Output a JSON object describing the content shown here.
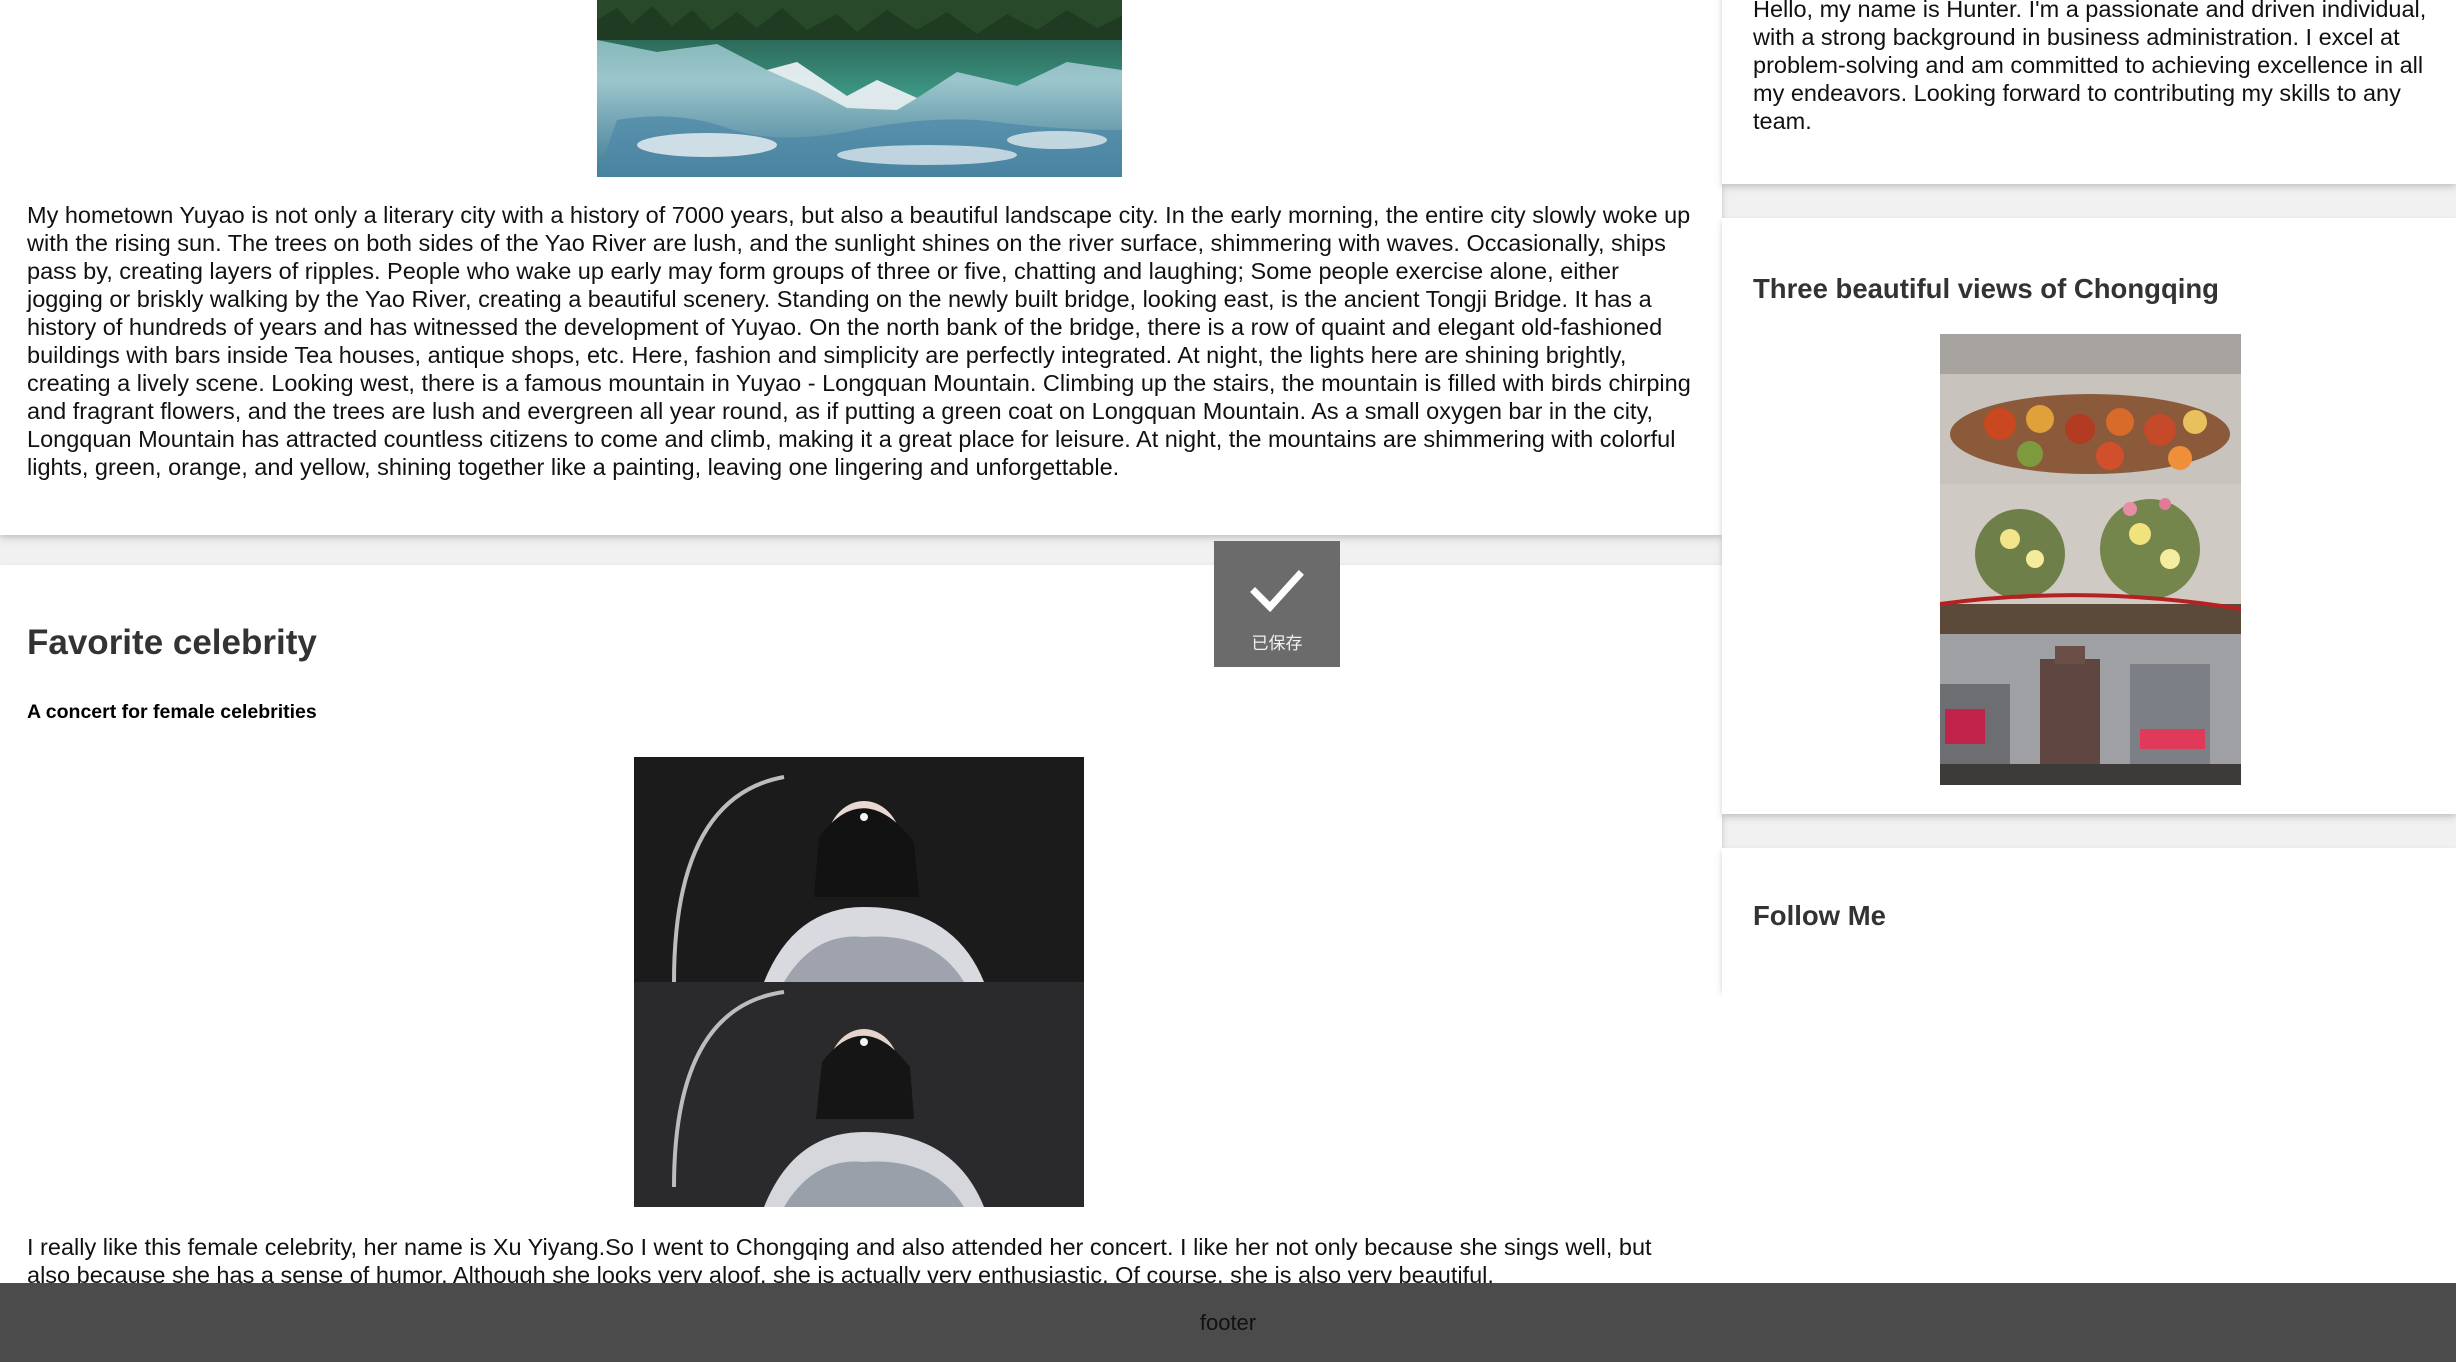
{
  "main": {
    "hometown_paragraph": "My hometown Yuyao is not only a literary city with a history of 7000 years, but also a beautiful landscape city. In the early morning, the entire city slowly woke up with the rising sun. The trees on both sides of the Yao River are lush, and the sunlight shines on the river surface, shimmering with waves. Occasionally, ships pass by, creating layers of ripples. People who wake up early may form groups of three or five, chatting and laughing; Some people exercise alone, either jogging or briskly walking by the Yao River, creating a beautiful scenery. Standing on the newly built bridge, looking east, is the ancient Tongji Bridge. It has a history of hundreds of years and has witnessed the development of Yuyao. On the north bank of the bridge, there is a row of quaint and elegant old-fashioned buildings with bars inside Tea houses, antique shops, etc. Here, fashion and simplicity are perfectly integrated. At night, the lights here are shining brightly, creating a lively scene. Looking west, there is a famous mountain in Yuyao - Longquan Mountain. Climbing up the stairs, the mountain is filled with birds chirping and fragrant flowers, and the trees are lush and evergreen all year round, as if putting a green coat on Longquan Mountain. As a small oxygen bar in the city, Longquan Mountain has attracted countless citizens to come and climb, making it a great place for leisure. At night, the mountains are shimmering with colorful lights, green, orange, and yellow, shining together like a painting, leaving one lingering and unforgettable.",
    "celebrity": {
      "title": "Favorite celebrity",
      "subtitle": "A concert for female celebrities",
      "paragraph": "I really like this female celebrity, her name is Xu Yiyang.So I went to Chongqing and also attended her concert. I like her not only because she sings well, but also because she has a sense of humor. Although she looks very aloof, she is actually very enthusiastic. Of course, she is also very beautiful."
    }
  },
  "sidebar": {
    "about_text": "Hello, my name is Hunter. I'm a passionate and driven individual, with a strong background in business administration. I excel at problem-solving and am committed to achieving excellence in all my endeavors. Looking forward to contributing my skills to any team.",
    "views_heading": "Three beautiful views of Chongqing",
    "follow_heading": "Follow Me"
  },
  "toast": {
    "label": "已保存",
    "icon": "checkmark-icon"
  },
  "footer": {
    "label": "footer"
  },
  "colors": {
    "footer_bg": "#4b4b4b",
    "toast_bg": "#6b6b6b",
    "card_bg": "#ffffff"
  }
}
